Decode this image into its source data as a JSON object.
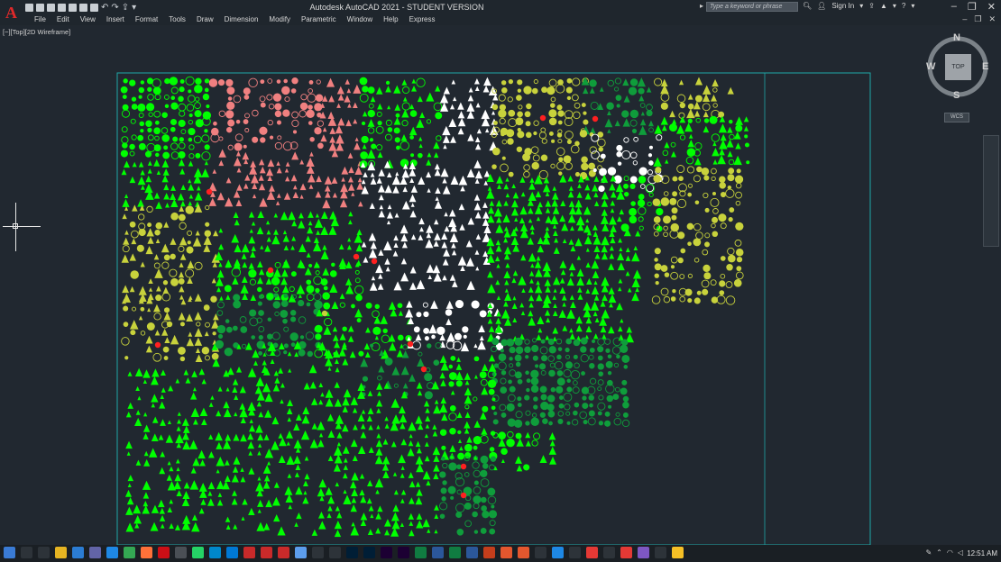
{
  "app": {
    "title": "Autodesk AutoCAD 2021 - STUDENT VERSION",
    "logo": "A",
    "search_placeholder": "Type a keyword or phrase",
    "sign_in": "Sign In"
  },
  "menu": [
    "File",
    "Edit",
    "View",
    "Insert",
    "Format",
    "Tools",
    "Draw",
    "Dimension",
    "Modify",
    "Parametric",
    "Window",
    "Help",
    "Express"
  ],
  "viewport": {
    "label": "[−][Top][2D Wireframe]"
  },
  "viewcube": {
    "north": "N",
    "south": "S",
    "east": "E",
    "west": "W",
    "face": "TOP",
    "wcs": "WCS"
  },
  "taskbar": {
    "time": "12:51 AM"
  },
  "colors": {
    "background": "#212830",
    "frame": "#1fa7a7",
    "bright_green": "#00ff00",
    "pink": "#f08080",
    "white": "#ffffff",
    "yellow_green": "#c8d23c",
    "dark_green": "#0f9d3b",
    "red": "#ff2020"
  }
}
